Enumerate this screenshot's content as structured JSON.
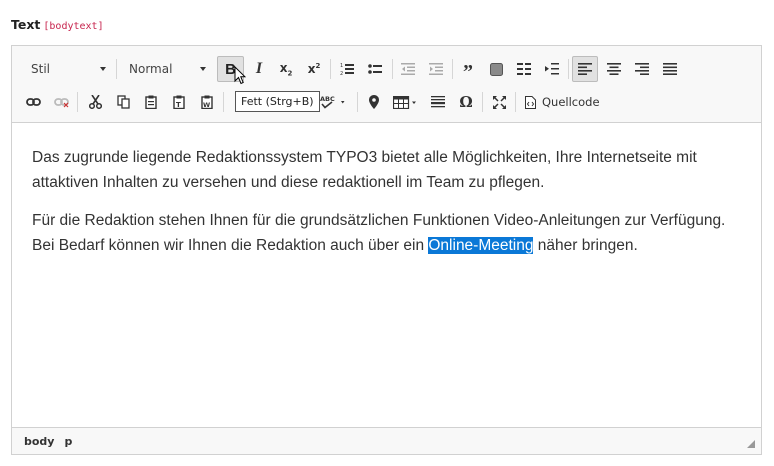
{
  "field": {
    "label": "Text",
    "code": "[bodytext]"
  },
  "toolbar": {
    "style_combo": "Stil",
    "format_combo": "Normal",
    "source_label": "Quellcode",
    "tooltip": "Fett (Strg+B)",
    "icons": [
      "bold-icon",
      "italic-icon",
      "subscript-icon",
      "superscript-icon",
      "numbered-list-icon",
      "bulleted-list-icon",
      "outdent-icon",
      "indent-icon",
      "blockquote-icon",
      "div-container-icon",
      "columns-icon",
      "insert-paragraph-icon",
      "align-left-icon",
      "align-center-icon",
      "align-right-icon",
      "justify-icon",
      "link-icon",
      "unlink-icon",
      "cut-icon",
      "copy-icon",
      "paste-icon",
      "paste-text-icon",
      "paste-word-icon",
      "spellcheck-icon",
      "map-marker-icon",
      "table-icon",
      "horizontal-line-icon",
      "special-char-icon",
      "maximize-icon",
      "source-icon"
    ]
  },
  "content": {
    "p1": "Das zugrunde liegende Redaktionssystem TYPO3 bietet alle Möglichkeiten, Ihre Internetseite mit attaktiven Inhalten zu versehen und diese redaktionell im Team zu pflegen.",
    "p2_before": "Für die Redaktion stehen Ihnen für die grundsätzlichen Funktionen Video-Anleitungen zur Verfügung. Bei Bedarf können wir Ihnen die Redaktion auch über ein ",
    "p2_selected": "Online-Meeting",
    "p2_after": " näher bringen."
  },
  "statusbar": {
    "path": [
      "body",
      "p"
    ]
  },
  "colors": {
    "selection": "#0a78d7",
    "label_code": "#c7254e"
  }
}
